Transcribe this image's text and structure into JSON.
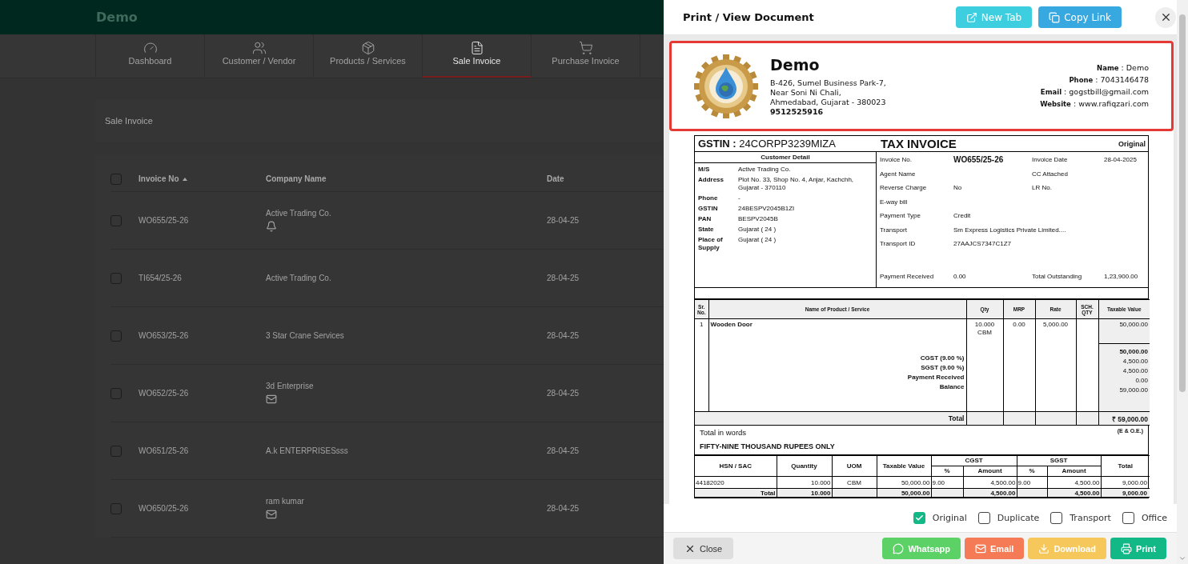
{
  "app": {
    "brand": "Demo"
  },
  "nav_tabs": [
    {
      "label": "Dashboard",
      "selected": false
    },
    {
      "label": "Customer / Vendor",
      "selected": false
    },
    {
      "label": "Products / Services",
      "selected": false
    },
    {
      "label": "Sale Invoice",
      "selected": true
    },
    {
      "label": "Purchase Invoice",
      "selected": false
    }
  ],
  "page_title": "Sale Invoice",
  "table": {
    "select_all": {
      "checked": false
    },
    "columns": [
      {
        "label": "Invoice No",
        "sorted": true
      },
      {
        "label": "Company Name",
        "sorted": false
      },
      {
        "label": "Date",
        "sorted": false
      }
    ],
    "rows": [
      {
        "invoice_no": "WO655/25-26",
        "company": "Active Trading Co.",
        "date": "28-04-25",
        "checked": false,
        "kind": "bell"
      },
      {
        "invoice_no": "TI654/25-26",
        "company": "Active Trading Co.",
        "date": "28-04-25",
        "checked": false,
        "kind": "plain"
      },
      {
        "invoice_no": "WO653/25-26",
        "company": "3 Star Crane Services",
        "date": "28-04-25",
        "checked": false,
        "kind": "plain"
      },
      {
        "invoice_no": "WO652/25-26",
        "company": "3d Enterprise",
        "date": "28-04-25",
        "checked": false,
        "kind": "mail"
      },
      {
        "invoice_no": "WO651/25-26",
        "company": "A.k ENTERPRISESsss",
        "date": "28-04-25",
        "checked": false,
        "kind": "plain"
      },
      {
        "invoice_no": "WO650/25-26",
        "company": "ram kumar",
        "date": "28-04-25",
        "checked": false,
        "kind": "mail"
      }
    ]
  },
  "dialog": {
    "title": "Print / View Document",
    "actions": [
      {
        "label": "New Tab",
        "kind": "newtab"
      },
      {
        "label": "Copy Link",
        "kind": "copy"
      }
    ],
    "letterhead": {
      "company": "Demo",
      "address_lines": [
        "B-426, Sumel Business Park-7,",
        "Near Soni Ni Chali,",
        "Ahmedabad, Gujarat - 380023"
      ],
      "phone": "9512525916",
      "contacts": [
        "**Name** : Demo",
        "**Phone** : 7043146478",
        "**Email** : gogstbill@gmail.com",
        "**Website** : www.rafiqzari.com"
      ]
    },
    "invoice": {
      "gstin": "**GSTIN :** 24CORPP3239MIZA",
      "title": "TAX INVOICE",
      "copy": "Original",
      "customer_heading": "Customer Detail",
      "customer": [
        {
          "label": "M/S",
          "value": "Active Trading Co."
        },
        {
          "label": "Address",
          "value": "Plot No. 33, Shop No. 4, Anjar, Kachchh, Gujarat - 370110"
        },
        {
          "label": "Phone",
          "value": "-"
        },
        {
          "label": "GSTIN",
          "value": "24BESPV2045B1ZI"
        },
        {
          "label": "PAN",
          "value": "BESPV2045B"
        },
        {
          "label": "State",
          "value": "Gujarat ( 24 )"
        },
        {
          "label": "Place of Supply",
          "value": "Gujarat ( 24 )"
        }
      ],
      "details": [
        {
          "items": [
            {
              "label": "Invoice No.",
              "value": "WO655/25-26"
            },
            {
              "label": "Invoice Date",
              "value": "28-04-2025"
            }
          ]
        },
        {
          "items": [
            {
              "label": "Agent Name"
            },
            {
              "label": "CC Attached"
            }
          ]
        },
        {
          "items": [
            {
              "label": "Reverse Charge",
              "value": "No"
            },
            {
              "label": "LR No."
            }
          ]
        },
        {
          "items": [
            {
              "label": "E-way bill"
            }
          ]
        },
        {
          "items": [
            {
              "label": "Payment Type",
              "value": "Credit"
            }
          ]
        },
        {
          "items": [
            {
              "label": "Transport",
              "value": "Sm Express Logistics Private Limited...."
            }
          ]
        },
        {
          "items": [
            {
              "label": "Transport ID",
              "value": "27AAJCS7347C1Z7"
            }
          ]
        },
        {
          "items": [
            {
              "label": "Payment Received",
              "value": "0.00"
            },
            {
              "label": "Total Outstanding",
              "value": "1,23,900.00"
            }
          ]
        }
      ],
      "product_columns": [
        "Sr. No.",
        "Name of Product / Service",
        "Qty",
        "MRP",
        "Rate",
        "SCH. QTY",
        "Taxable Value"
      ],
      "items": [
        {
          "sr": "1",
          "name": "Wooden Door",
          "qty": "10.000",
          "unit": "CBM",
          "mrp": "0.00",
          "rate": "5,000.00",
          "taxable": "50,000.00"
        }
      ],
      "subtotal": "50,000.00",
      "summary": [
        {
          "label": "CGST (9.00 %)",
          "value": "4,500.00"
        },
        {
          "label": "SGST (9.00 %)",
          "value": "4,500.00"
        },
        {
          "label": "Payment Received",
          "value": "0.00"
        },
        {
          "label": "Balance",
          "value": "59,000.00"
        }
      ],
      "total_label": "Total",
      "total": "₹ 59,000.00",
      "words_label": "Total in words",
      "words": "FIFTY-NINE THOUSAND RUPEES ONLY",
      "eoe": "(E & O.E.)",
      "hsn_headers": {
        "hsn": "HSN / SAC",
        "quantity": "Quantity",
        "uom": "UOM",
        "taxable": "Taxable Value",
        "cgst": "CGST",
        "sgst": "SGST",
        "cgst_rate": "%",
        "cgst_amount": "Amount",
        "sgst_rate": "%",
        "sgst_amount": "Amount",
        "total": "Total"
      },
      "hsn_rows": [
        {
          "hsn": "44182020",
          "quantity": "10.000",
          "uom": "CBM",
          "taxable": "50,000.00",
          "cgst_rate": "9.00",
          "cgst_amount": "4,500.00",
          "sgst_rate": "9.00",
          "sgst_amount": "4,500.00",
          "total": "9,000.00"
        }
      ],
      "hsn_total": {
        "label": "Total",
        "quantity": "10.000",
        "taxable": "50,000.00",
        "cgst_amount": "4,500.00",
        "sgst_amount": "4,500.00",
        "total": "9,000.00"
      }
    },
    "copy_options": [
      {
        "label": "Original",
        "checked": true
      },
      {
        "label": "Duplicate",
        "checked": false
      },
      {
        "label": "Transport",
        "checked": false
      },
      {
        "label": "Office",
        "checked": false
      }
    ],
    "footer_buttons": [
      {
        "label": "Close",
        "kind": "close"
      },
      {
        "label": "Whatsapp",
        "kind": "whatsapp"
      },
      {
        "label": "Email",
        "kind": "email"
      },
      {
        "label": "Download",
        "kind": "download"
      },
      {
        "label": "Print",
        "kind": "print"
      }
    ]
  }
}
